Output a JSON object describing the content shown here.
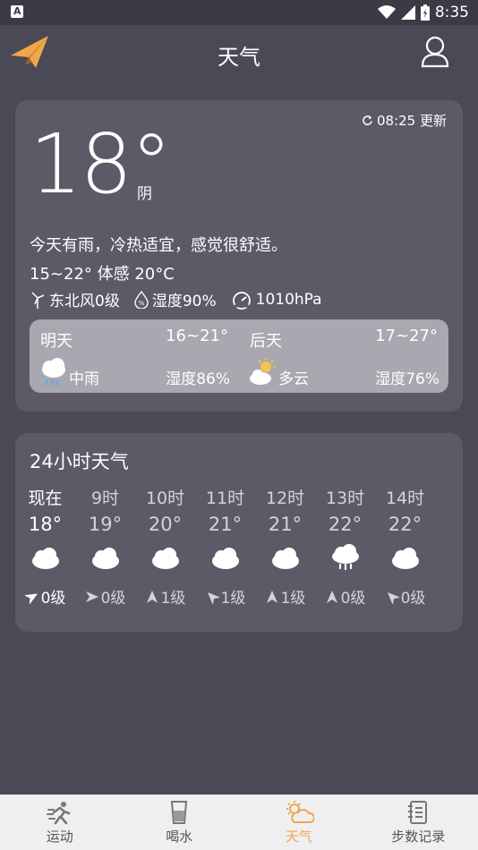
{
  "status_bar": {
    "time": "8:35"
  },
  "header": {
    "title": "天气"
  },
  "current": {
    "update_time": "08:25 更新",
    "temperature": "18°",
    "condition": "阴",
    "description": "今天有雨，冷热适宜，感觉很舒适。",
    "range": "15~22°  体感 20°C",
    "wind": "东北风0级",
    "humidity": "湿度90%",
    "pressure": "1010hPa"
  },
  "forecast": [
    {
      "day": "明天",
      "range": "16~21°",
      "weather": "中雨",
      "humidity": "湿度86%",
      "icon": "rain-cloud-icon"
    },
    {
      "day": "后天",
      "range": "17~27°",
      "weather": "多云",
      "humidity": "湿度76%",
      "icon": "partly-cloudy-icon"
    }
  ],
  "hourly_title": "24小时天气",
  "hourly": [
    {
      "time": "现在",
      "temp": "18°",
      "wind": "0级",
      "icon": "cloud-icon",
      "dir": 60
    },
    {
      "time": "9时",
      "temp": "19°",
      "wind": "0级",
      "icon": "cloud-icon",
      "dir": 90
    },
    {
      "time": "10时",
      "temp": "20°",
      "wind": "1级",
      "icon": "cloud-icon",
      "dir": 0
    },
    {
      "time": "11时",
      "temp": "21°",
      "wind": "1级",
      "icon": "cloud-icon",
      "dir": -45
    },
    {
      "time": "12时",
      "temp": "21°",
      "wind": "1级",
      "icon": "cloud-icon",
      "dir": 0
    },
    {
      "time": "13时",
      "temp": "22°",
      "wind": "0级",
      "icon": "rain-cloud-icon",
      "dir": 0
    },
    {
      "time": "14时",
      "temp": "22°",
      "wind": "0级",
      "icon": "cloud-icon",
      "dir": -45
    }
  ],
  "nav": [
    {
      "label": "运动",
      "icon": "run-icon",
      "active": false
    },
    {
      "label": "喝水",
      "icon": "cup-icon",
      "active": false
    },
    {
      "label": "天气",
      "icon": "weather-icon",
      "active": true
    },
    {
      "label": "步数记录",
      "icon": "notebook-icon",
      "active": false
    }
  ],
  "colors": {
    "background": "#4a4956",
    "card": "#5b5a66",
    "accent": "#f0a74a"
  }
}
